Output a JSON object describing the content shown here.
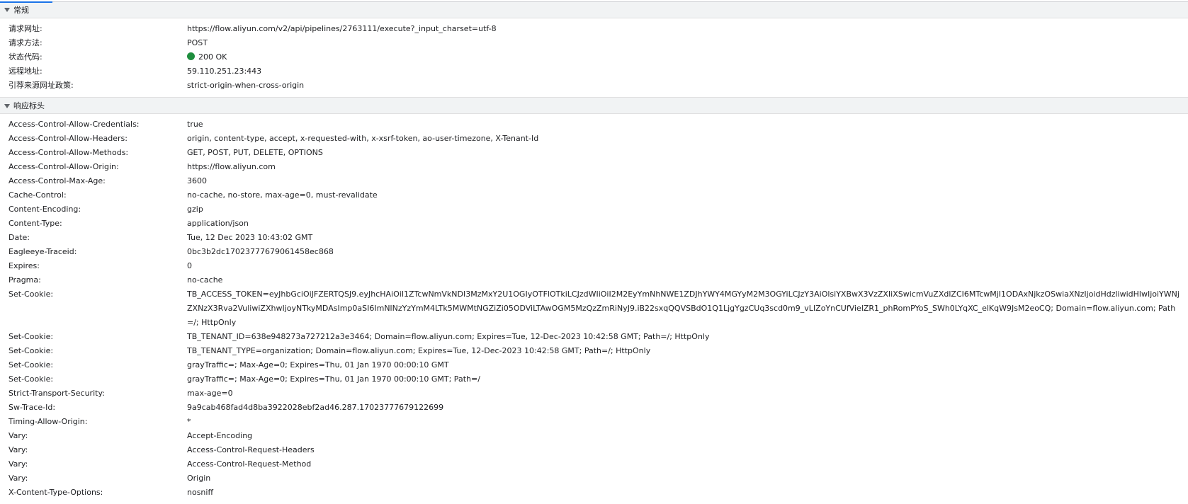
{
  "general": {
    "title": "常规",
    "rows": [
      {
        "key": "请求网址:",
        "value": "https://flow.aliyun.com/v2/api/pipelines/2763111/execute?_input_charset=utf-8"
      },
      {
        "key": "请求方法:",
        "value": "POST"
      },
      {
        "key": "状态代码:",
        "value": "200 OK"
      },
      {
        "key": "远程地址:",
        "value": "59.110.251.23:443"
      },
      {
        "key": "引荐来源网址政策:",
        "value": "strict-origin-when-cross-origin"
      }
    ],
    "status_color": "#1e8e3e"
  },
  "response_headers": {
    "title": "响应标头",
    "rows": [
      {
        "key": "Access-Control-Allow-Credentials:",
        "value": "true"
      },
      {
        "key": "Access-Control-Allow-Headers:",
        "value": "origin, content-type, accept, x-requested-with, x-xsrf-token, ao-user-timezone, X-Tenant-Id"
      },
      {
        "key": "Access-Control-Allow-Methods:",
        "value": "GET, POST, PUT, DELETE, OPTIONS"
      },
      {
        "key": "Access-Control-Allow-Origin:",
        "value": "https://flow.aliyun.com"
      },
      {
        "key": "Access-Control-Max-Age:",
        "value": "3600"
      },
      {
        "key": "Cache-Control:",
        "value": "no-cache, no-store, max-age=0, must-revalidate"
      },
      {
        "key": "Content-Encoding:",
        "value": "gzip"
      },
      {
        "key": "Content-Type:",
        "value": "application/json"
      },
      {
        "key": "Date:",
        "value": "Tue, 12 Dec 2023 10:43:02 GMT"
      },
      {
        "key": "Eagleeye-Traceid:",
        "value": "0bc3b2dc17023777679061458ec868"
      },
      {
        "key": "Expires:",
        "value": "0"
      },
      {
        "key": "Pragma:",
        "value": "no-cache"
      },
      {
        "key": "Set-Cookie:",
        "value": "TB_ACCESS_TOKEN=eyJhbGciOiJFZERTQSJ9.eyJhcHAiOiI1ZTcwNmVkNDI3MzMxY2U1OGIyOTFlOTkiLCJzdWIiOiI2M2EyYmNhNWE1ZDJhYWY4MGYyM2M3OGYiLCJzY3AiOlsiYXBwX3VzZXIiXSwicmVuZXdlZCI6MTcwMjI1ODAxNjkzOSwiaXNzIjoidHdzliwidHlwIjoiYWNjZXNzX3Rva2VuliwiZXhwIjoyNTkyMDAsImp0aSI6ImNlNzYzYmM4LTk5MWMtNGZiZi05ODViLTAwOGM5MzQzZmRiNyJ9.iB22sxqQQVSBdO1Q1LjgYgzCUq3scd0m9_vLIZoYnCUfVielZR1_phRomPYoS_SWh0LYqXC_elKqW9JsM2eoCQ; Domain=flow.aliyun.com; Path=/; HttpOnly",
        "multi": true
      },
      {
        "key": "Set-Cookie:",
        "value": "TB_TENANT_ID=638e948273a727212a3e3464; Domain=flow.aliyun.com; Expires=Tue, 12-Dec-2023 10:42:58 GMT; Path=/; HttpOnly"
      },
      {
        "key": "Set-Cookie:",
        "value": "TB_TENANT_TYPE=organization; Domain=flow.aliyun.com; Expires=Tue, 12-Dec-2023 10:42:58 GMT; Path=/; HttpOnly"
      },
      {
        "key": "Set-Cookie:",
        "value": "grayTraffic=; Max-Age=0; Expires=Thu, 01 Jan 1970 00:00:10 GMT"
      },
      {
        "key": "Set-Cookie:",
        "value": "grayTraffic=; Max-Age=0; Expires=Thu, 01 Jan 1970 00:00:10 GMT; Path=/"
      },
      {
        "key": "Strict-Transport-Security:",
        "value": "max-age=0"
      },
      {
        "key": "Sw-Trace-Id:",
        "value": "9a9cab468fad4d8ba3922028ebf2ad46.287.17023777679122699"
      },
      {
        "key": "Timing-Allow-Origin:",
        "value": "*"
      },
      {
        "key": "Vary:",
        "value": "Accept-Encoding"
      },
      {
        "key": "Vary:",
        "value": "Access-Control-Request-Headers"
      },
      {
        "key": "Vary:",
        "value": "Access-Control-Request-Method"
      },
      {
        "key": "Vary:",
        "value": "Origin"
      },
      {
        "key": "X-Content-Type-Options:",
        "value": "nosniff"
      }
    ]
  },
  "icons": {
    "section_toggle": "triangle-down-icon",
    "status": "status-dot-icon"
  },
  "colors": {
    "accent": "#1a73e8",
    "header_bg": "#f1f3f4",
    "divider": "#e0e0e0"
  }
}
